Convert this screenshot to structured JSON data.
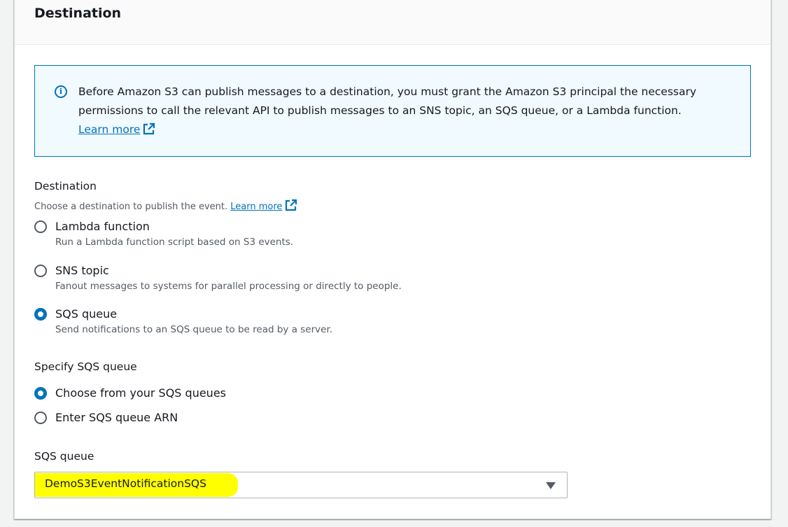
{
  "panel": {
    "title": "Destination"
  },
  "info_alert": {
    "text": "Before Amazon S3 can publish messages to a destination, you must grant the Amazon S3 principal the necessary permissions to call the relevant API to publish messages to an SNS topic, an SQS queue, or a Lambda function.",
    "link_label": "Learn more"
  },
  "destination": {
    "label": "Destination",
    "description": "Choose a destination to publish the event.",
    "link_label": "Learn more",
    "options": [
      {
        "label": "Lambda function",
        "description": "Run a Lambda function script based on S3 events.",
        "checked": false
      },
      {
        "label": "SNS topic",
        "description": "Fanout messages to systems for parallel processing or directly to people.",
        "checked": false
      },
      {
        "label": "SQS queue",
        "description": "Send notifications to an SQS queue to be read by a server.",
        "checked": true
      }
    ]
  },
  "specify_sqs": {
    "label": "Specify SQS queue",
    "options": [
      {
        "label": "Choose from your SQS queues",
        "checked": true
      },
      {
        "label": "Enter SQS queue ARN",
        "checked": false
      }
    ]
  },
  "sqs_queue": {
    "label": "SQS queue",
    "selected_value": "DemoS3EventNotificationSQS"
  },
  "colors": {
    "accent": "#0073bb",
    "alert_background": "#f1faff",
    "highlight": "#ffff00"
  }
}
